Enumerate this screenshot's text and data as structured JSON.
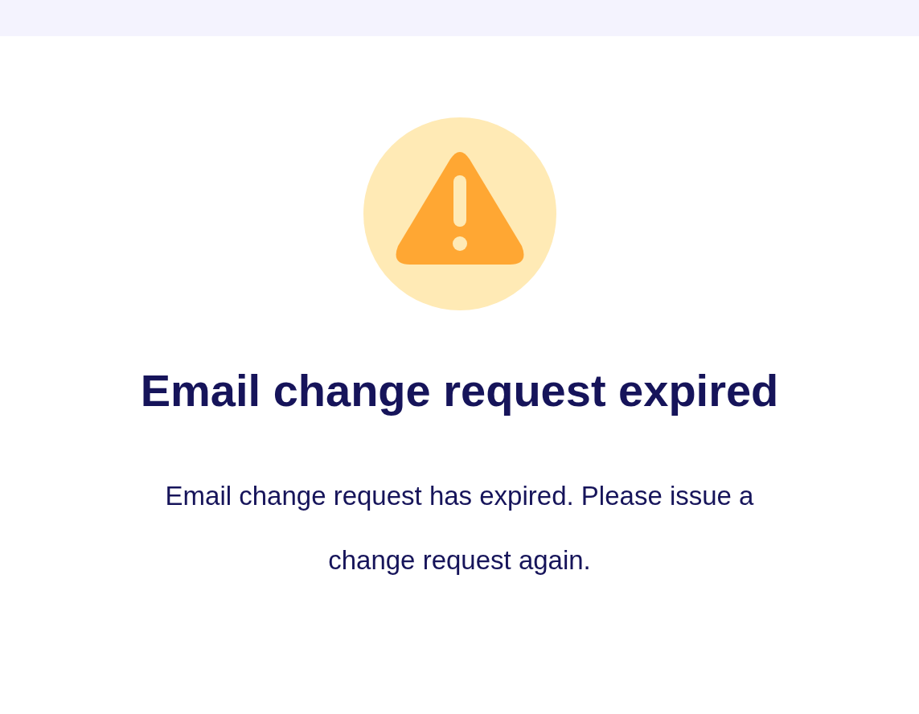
{
  "title": "Email change request expired",
  "message": "Email change request has expired. Please issue a change request again."
}
